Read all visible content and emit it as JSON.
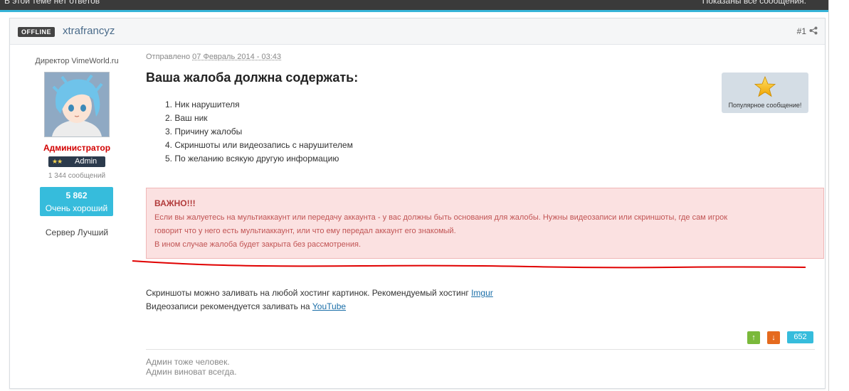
{
  "topbar": {
    "left_text": "В этой теме нет ответов",
    "right_text": "Показаны все сообщения."
  },
  "post": {
    "status_badge": "OFFLINE",
    "username": "xtrafrancyz",
    "post_number": "#1",
    "author": {
      "title": "Директор VimeWorld.ru",
      "group": "Администратор",
      "rank_stars": "★★",
      "rank_label": "Admin",
      "post_count": "1 344 сообщений",
      "reputation_value": "5 862",
      "reputation_label": "Очень хороший",
      "server": "Сервер Лучший"
    },
    "posted_prefix": "Отправлено",
    "posted_date": "07 Февраль 2014 - 03:43",
    "heading": "Ваша жалоба должна содержать:",
    "requirements": [
      "1. Ник нарушителя",
      "2. Ваш ник",
      "3. Причину жалобы",
      "4. Скриншоты или видеозапись с нарушителем",
      "5. По желанию всякую другую информацию"
    ],
    "popular_label": "Популярное сообщение!",
    "alert": {
      "title": "ВАЖНО!!!",
      "lines": [
        "Если вы жалуетесь на мультиаккаунт или передачу аккаунта - у вас должны быть основания для жалобы. Нужны видеозаписи или скриншоты, где сам игрок",
        "говорит что у него есть мультиаккаунт, или что ему передал аккаунт его знакомый.",
        "В ином случае жалоба будет закрыта без рассмотрения."
      ]
    },
    "para1_text": "Скриншоты можно заливать на любой хостинг картинок. Рекомендуемый хостинг",
    "para1_link": "Imgur",
    "para2_text": "Видеозаписи рекомендуется заливать на",
    "para2_link": "YouTube",
    "vote_up": "↑",
    "vote_down": "↓",
    "vote_count": "652",
    "signature": [
      "Админ тоже человек.",
      "Админ виноват всегда."
    ]
  },
  "colors": {
    "accent": "#36bcdc",
    "admin_red": "#d20000",
    "alert_bg": "#fbe1e1",
    "alert_text": "#c15454",
    "link": "#1a6ea8"
  }
}
